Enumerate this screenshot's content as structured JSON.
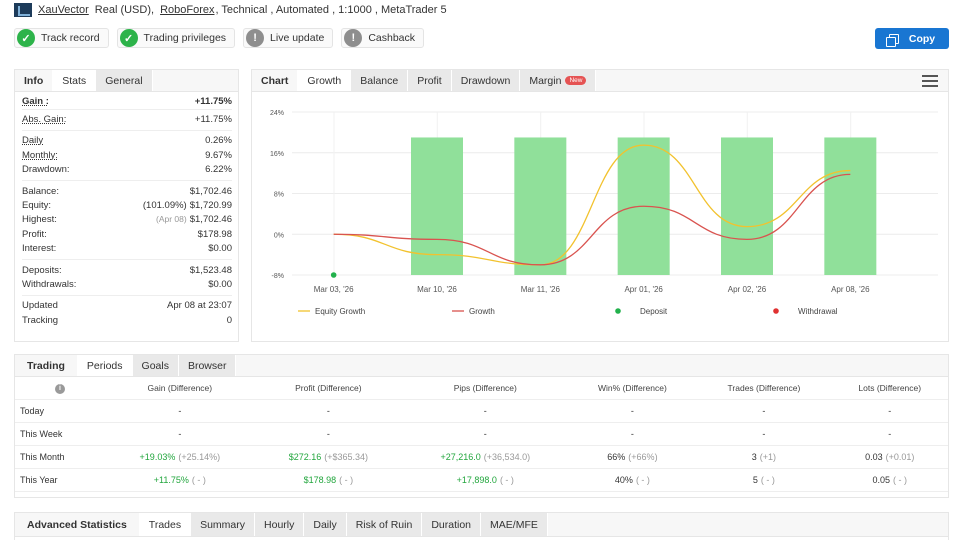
{
  "header": {
    "account_name": "XauVector",
    "account_type": "Real (USD),",
    "broker": "RoboForex",
    "details": ", Technical , Automated , 1:1000 , MetaTrader 5"
  },
  "badges": [
    {
      "label": "Track record",
      "status": "ok"
    },
    {
      "label": "Trading privileges",
      "status": "ok"
    },
    {
      "label": "Live update",
      "status": "no"
    },
    {
      "label": "Cashback",
      "status": "no"
    }
  ],
  "copy_button": {
    "label": "Copy"
  },
  "stats_tabs": [
    "Info",
    "Stats",
    "General"
  ],
  "stats": {
    "gain": {
      "label": "Gain :",
      "value": "+11.75%"
    },
    "abs_gain": {
      "label": "Abs. Gain:",
      "value": "+11.75%"
    },
    "daily": {
      "label": "Daily",
      "value": "0.26%"
    },
    "monthly": {
      "label": "Monthly:",
      "value": "9.67%"
    },
    "drawdown": {
      "label": "Drawdown:",
      "value": "6.22%"
    },
    "balance": {
      "label": "Balance:",
      "value": "$1,702.46"
    },
    "equity": {
      "label": "Equity:",
      "pre": "(101.09%)",
      "value": "$1,720.99"
    },
    "highest": {
      "label": "Highest:",
      "pre": "(Apr 08)",
      "value": "$1,702.46"
    },
    "profit": {
      "label": "Profit:",
      "value": "$178.98"
    },
    "interest": {
      "label": "Interest:",
      "value": "$0.00"
    },
    "deposits": {
      "label": "Deposits:",
      "value": "$1,523.48"
    },
    "withdrawals": {
      "label": "Withdrawals:",
      "value": "$0.00"
    },
    "updated": {
      "label": "Updated",
      "value": "Apr 08 at 23:07"
    },
    "tracking": {
      "label": "Tracking",
      "value": "0"
    }
  },
  "chart_tabs": [
    "Chart",
    "Growth",
    "Balance",
    "Profit",
    "Drawdown",
    "Margin"
  ],
  "margin_badge": "New",
  "chart_data": {
    "type": "bar",
    "categories": [
      "Mar 03, '26",
      "Mar 10, '26",
      "Mar 11, '26",
      "Apr 01, '26",
      "Apr 02, '26",
      "Apr 08, '26"
    ],
    "ylim": [
      -8,
      24
    ],
    "yticks": [
      "24%",
      "16%",
      "8%",
      "0%",
      "-8%"
    ],
    "ytick_values": [
      24,
      16,
      8,
      0,
      -8
    ],
    "bars": [
      null,
      19,
      19,
      19,
      19,
      19
    ],
    "series": [
      {
        "name": "Equity Growth",
        "color": "#f2c22e",
        "values": [
          0,
          -4,
          -6,
          17.5,
          1.5,
          12.5
        ]
      },
      {
        "name": "Growth",
        "color": "#d9534f",
        "values": [
          0,
          -1,
          -6,
          5.5,
          -1,
          11.75
        ]
      }
    ],
    "deposit_points": [
      {
        "x_index": 0,
        "y": -8
      }
    ],
    "legend": [
      "Equity Growth",
      "Growth",
      "Deposit",
      "Withdrawal"
    ],
    "legend_colors": [
      "#f2c22e",
      "#d9534f",
      "#22b14c",
      "#e03131"
    ],
    "bar_color": "#90e09a"
  },
  "periods_tabs": [
    "Trading",
    "Periods",
    "Goals",
    "Browser"
  ],
  "periods": {
    "columns": [
      "Gain (Difference)",
      "Profit (Difference)",
      "Pips (Difference)",
      "Win% (Difference)",
      "Trades (Difference)",
      "Lots (Difference)"
    ],
    "rows": [
      {
        "label": "Today",
        "cells": [
          [
            "-",
            ""
          ],
          [
            "-",
            ""
          ],
          [
            "-",
            ""
          ],
          [
            "-",
            ""
          ],
          [
            "-",
            ""
          ],
          [
            "-",
            ""
          ]
        ]
      },
      {
        "label": "This Week",
        "cells": [
          [
            "-",
            ""
          ],
          [
            "-",
            ""
          ],
          [
            "-",
            ""
          ],
          [
            "-",
            ""
          ],
          [
            "-",
            ""
          ],
          [
            "-",
            ""
          ]
        ]
      },
      {
        "label": "This Month",
        "cells": [
          [
            "+19.03%",
            "(+25.14%)"
          ],
          [
            "$272.16",
            "(+$365.34)"
          ],
          [
            "+27,216.0",
            "(+36,534.0)"
          ],
          [
            "66%",
            "(+66%)"
          ],
          [
            "3",
            "(+1)"
          ],
          [
            "0.03",
            "(+0.01)"
          ]
        ]
      },
      {
        "label": "This Year",
        "cells": [
          [
            "+11.75%",
            "( - )"
          ],
          [
            "$178.98",
            "( - )"
          ],
          [
            "+17,898.0",
            "( - )"
          ],
          [
            "40%",
            "( - )"
          ],
          [
            "5",
            "( - )"
          ],
          [
            "0.05",
            "( - )"
          ]
        ]
      }
    ]
  },
  "adv_tabs": [
    "Advanced Statistics",
    "Trades",
    "Summary",
    "Hourly",
    "Daily",
    "Risk of Ruin",
    "Duration",
    "MAE/MFE"
  ]
}
